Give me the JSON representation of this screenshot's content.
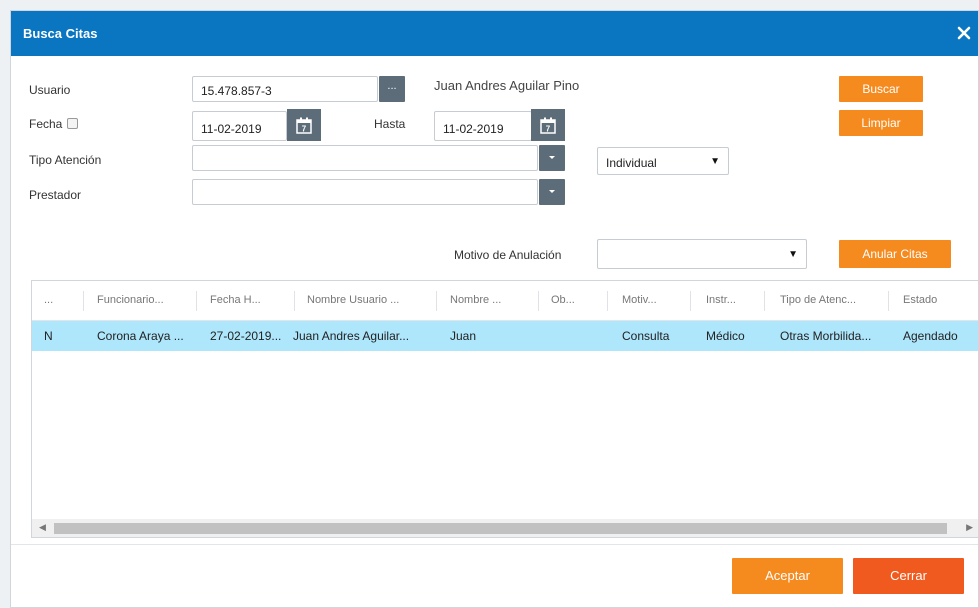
{
  "dialog": {
    "title": "Busca Citas",
    "close_icon": "close-icon"
  },
  "form": {
    "usuario_label": "Usuario",
    "usuario_value": "15.478.857-3",
    "usuario_lookup_label": "...",
    "usuario_name": "Juan Andres Aguilar Pino",
    "fecha_label": "Fecha",
    "fecha_checked": false,
    "fecha_from": "11-02-2019",
    "hasta_label": "Hasta",
    "fecha_to": "11-02-2019",
    "calendar_day": "7",
    "tipo_atencion_label": "Tipo Atención",
    "tipo_atencion_value": "",
    "modo_value": "Individual",
    "prestador_label": "Prestador",
    "prestador_value": "",
    "motivo_anulacion_label": "Motivo de Anulación",
    "motivo_anulacion_value": ""
  },
  "buttons": {
    "buscar": "Buscar",
    "limpiar": "Limpiar",
    "anular_citas": "Anular Citas",
    "aceptar": "Aceptar",
    "cerrar": "Cerrar"
  },
  "table": {
    "columns": [
      "...",
      "Funcionario...",
      "Fecha H...",
      "Nombre Usuario ...",
      "Nombre ...",
      "Ob...",
      "Motiv...",
      "Instr...",
      "Tipo de Atenc...",
      "Estado"
    ],
    "rows": [
      [
        "N",
        "Corona Araya ...",
        "27-02-2019...",
        "Juan Andres Aguilar...",
        "Juan",
        "",
        "Consulta",
        "Médico",
        "Otras Morbilida...",
        "Agendado"
      ]
    ]
  },
  "colors": {
    "titlebar": "#0a76c2",
    "accent_orange": "#f58a1f",
    "close_button": "#f05a1e",
    "selected_row": "#aee6fb"
  }
}
